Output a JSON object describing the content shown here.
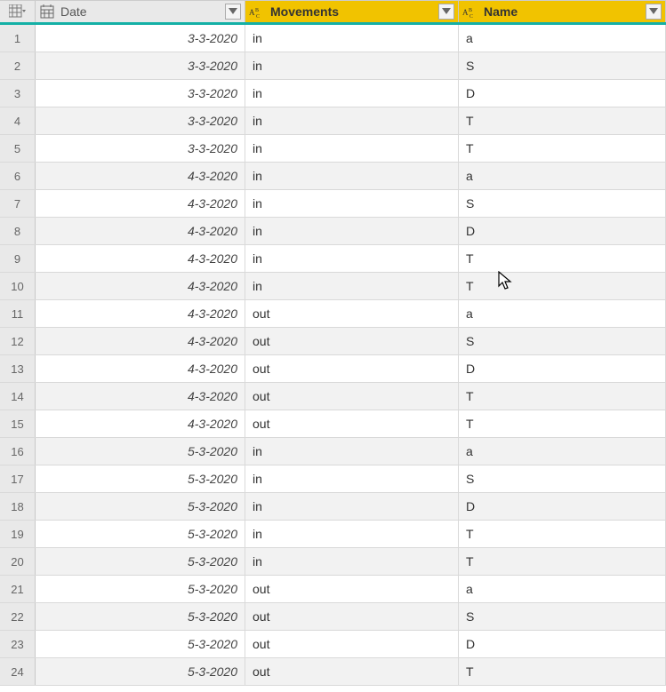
{
  "columns": {
    "date": {
      "label": "Date",
      "type": "date"
    },
    "movements": {
      "label": "Movements",
      "type": "text"
    },
    "name": {
      "label": "Name",
      "type": "text"
    }
  },
  "rows": [
    {
      "n": "1",
      "date": "3-3-2020",
      "mov": "in",
      "name": "a"
    },
    {
      "n": "2",
      "date": "3-3-2020",
      "mov": "in",
      "name": "S"
    },
    {
      "n": "3",
      "date": "3-3-2020",
      "mov": "in",
      "name": "D"
    },
    {
      "n": "4",
      "date": "3-3-2020",
      "mov": "in",
      "name": "T"
    },
    {
      "n": "5",
      "date": "3-3-2020",
      "mov": "in",
      "name": "T"
    },
    {
      "n": "6",
      "date": "4-3-2020",
      "mov": "in",
      "name": "a"
    },
    {
      "n": "7",
      "date": "4-3-2020",
      "mov": "in",
      "name": "S"
    },
    {
      "n": "8",
      "date": "4-3-2020",
      "mov": "in",
      "name": "D"
    },
    {
      "n": "9",
      "date": "4-3-2020",
      "mov": "in",
      "name": "T"
    },
    {
      "n": "10",
      "date": "4-3-2020",
      "mov": "in",
      "name": "T"
    },
    {
      "n": "11",
      "date": "4-3-2020",
      "mov": "out",
      "name": "a"
    },
    {
      "n": "12",
      "date": "4-3-2020",
      "mov": "out",
      "name": "S"
    },
    {
      "n": "13",
      "date": "4-3-2020",
      "mov": "out",
      "name": "D"
    },
    {
      "n": "14",
      "date": "4-3-2020",
      "mov": "out",
      "name": "T"
    },
    {
      "n": "15",
      "date": "4-3-2020",
      "mov": "out",
      "name": "T"
    },
    {
      "n": "16",
      "date": "5-3-2020",
      "mov": "in",
      "name": "a"
    },
    {
      "n": "17",
      "date": "5-3-2020",
      "mov": "in",
      "name": "S"
    },
    {
      "n": "18",
      "date": "5-3-2020",
      "mov": "in",
      "name": "D"
    },
    {
      "n": "19",
      "date": "5-3-2020",
      "mov": "in",
      "name": "T"
    },
    {
      "n": "20",
      "date": "5-3-2020",
      "mov": "in",
      "name": "T"
    },
    {
      "n": "21",
      "date": "5-3-2020",
      "mov": "out",
      "name": "a"
    },
    {
      "n": "22",
      "date": "5-3-2020",
      "mov": "out",
      "name": "S"
    },
    {
      "n": "23",
      "date": "5-3-2020",
      "mov": "out",
      "name": "D"
    },
    {
      "n": "24",
      "date": "5-3-2020",
      "mov": "out",
      "name": "T"
    }
  ]
}
